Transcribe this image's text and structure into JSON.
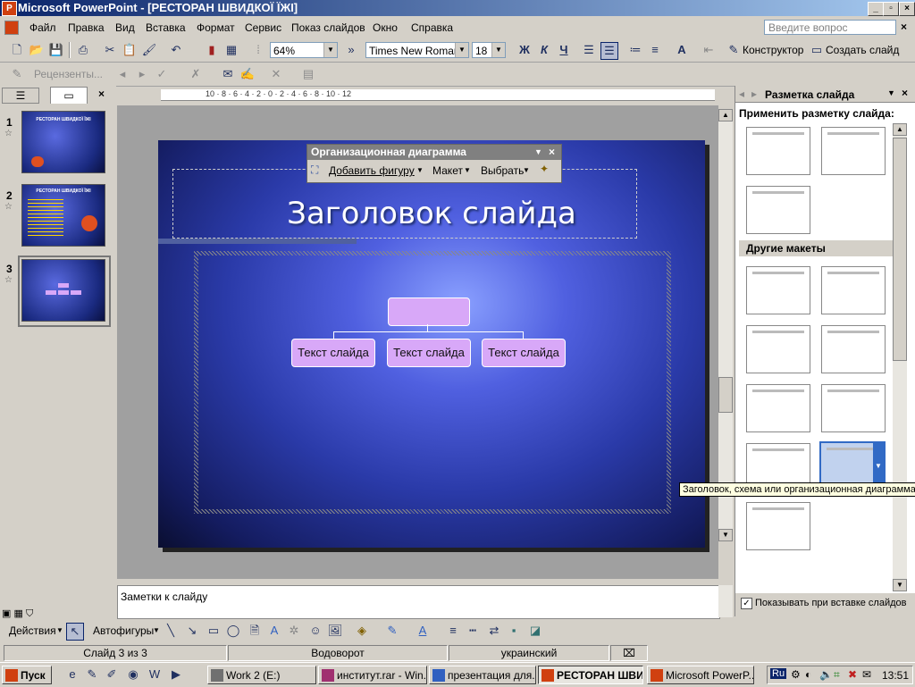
{
  "window": {
    "title": "Microsoft PowerPoint - [РЕСТОРАН ШВИДКОЇ ЇЖІ]"
  },
  "menu": {
    "items": [
      "Файл",
      "Правка",
      "Вид",
      "Вставка",
      "Формат",
      "Сервис",
      "Показ слайдов",
      "Окно",
      "Справка"
    ],
    "ask_placeholder": "Введите вопрос"
  },
  "toolbar": {
    "zoom": "64%",
    "font": "Times New Roman",
    "font_size": "18",
    "bold": "Ж",
    "italic": "К",
    "underline": "Ч",
    "designer": "Конструктор",
    "new_slide": "Создать слайд",
    "reviewers": "Рецензенты..."
  },
  "left_panel": {
    "slides": [
      {
        "num": "1",
        "title": "РЕСТОРАН ШВИДКОЇ ЇЖІ"
      },
      {
        "num": "2",
        "title": "РЕСТОРАН ШВИДКОЇ ЇЖІ"
      },
      {
        "num": "3",
        "title": ""
      }
    ]
  },
  "slide": {
    "title": "Заголовок слайда",
    "boxes": [
      "Текст слайда",
      "Текст слайда",
      "Текст слайда"
    ]
  },
  "org_toolbar": {
    "title": "Организационная диаграмма",
    "add_shape": "Добавить фигуру",
    "layout": "Макет",
    "select": "Выбрать"
  },
  "task_pane": {
    "title": "Разметка слайда",
    "apply_label": "Применить разметку слайда:",
    "other_layouts": "Другие макеты",
    "show_on_insert": "Показывать при вставке слайдов",
    "tooltip": "Заголовок, схема или организационная диаграмма"
  },
  "notes": {
    "placeholder": "Заметки к слайду"
  },
  "drawing": {
    "actions": "Действия",
    "autoshapes": "Автофигуры"
  },
  "status": {
    "slide": "Слайд 3 из 3",
    "design": "Водоворот",
    "language": "украинский"
  },
  "taskbar": {
    "start": "Пуск",
    "tasks": [
      "Work 2 (E:)",
      "институт.rar - Win...",
      "презентация для...",
      "РЕСТОРАН ШВИД...",
      "Microsoft PowerP..."
    ],
    "lang": "Ru",
    "clock": "13:51"
  }
}
